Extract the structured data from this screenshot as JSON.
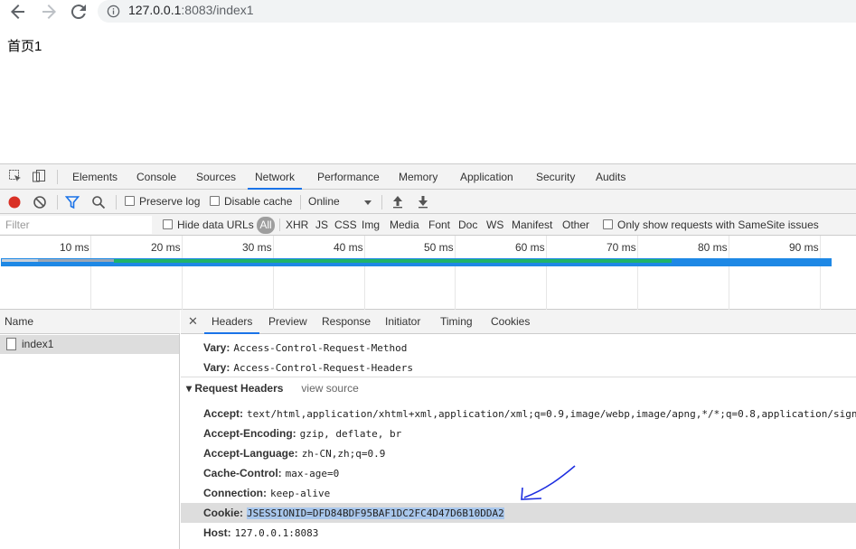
{
  "browser": {
    "url_host": "127.0.0.1",
    "url_rest": ":8083/index1"
  },
  "page": {
    "text": "首页1"
  },
  "devtools": {
    "tabs": [
      "Elements",
      "Console",
      "Sources",
      "Network",
      "Performance",
      "Memory",
      "Application",
      "Security",
      "Audits"
    ],
    "active_tab": "Network",
    "toolbar": {
      "preserve_log": "Preserve log",
      "disable_cache": "Disable cache",
      "throttling": "Online"
    },
    "filter": {
      "placeholder": "Filter",
      "hide_data_urls": "Hide data URLs",
      "all": "All",
      "types": [
        "XHR",
        "JS",
        "CSS",
        "Img",
        "Media",
        "Font",
        "Doc",
        "WS",
        "Manifest",
        "Other"
      ],
      "samesite": "Only show requests with SameSite issues"
    },
    "timeline": {
      "ticks": [
        "10 ms",
        "20 ms",
        "30 ms",
        "40 ms",
        "50 ms",
        "60 ms",
        "70 ms",
        "80 ms",
        "90 ms"
      ]
    },
    "requests": {
      "column_name": "Name",
      "rows": [
        "index1"
      ]
    },
    "detail": {
      "tabs": [
        "Headers",
        "Preview",
        "Response",
        "Initiator",
        "Timing",
        "Cookies"
      ],
      "active_tab": "Headers",
      "response_headers_tail": [
        {
          "name": "Vary:",
          "value": "Access-Control-Request-Method"
        },
        {
          "name": "Vary:",
          "value": "Access-Control-Request-Headers"
        }
      ],
      "request_headers_title": "Request Headers",
      "view_source": "view source",
      "request_headers": [
        {
          "name": "Accept:",
          "value": "text/html,application/xhtml+xml,application/xml;q=0.9,image/webp,image/apng,*/*;q=0.8,application/signe"
        },
        {
          "name": "Accept-Encoding:",
          "value": "gzip, deflate, br"
        },
        {
          "name": "Accept-Language:",
          "value": "zh-CN,zh;q=0.9"
        },
        {
          "name": "Cache-Control:",
          "value": "max-age=0"
        },
        {
          "name": "Connection:",
          "value": "keep-alive"
        },
        {
          "name": "Cookie:",
          "value": "JSESSIONID=DFD84BDF95BAF1DC2FC4D47D6B10DDA2"
        },
        {
          "name": "Host:",
          "value": "127.0.0.1:8083"
        }
      ]
    }
  },
  "colors": {
    "accent": "#1a73e8",
    "record": "#d93025",
    "annotation_arrow": "#1c2de0"
  }
}
